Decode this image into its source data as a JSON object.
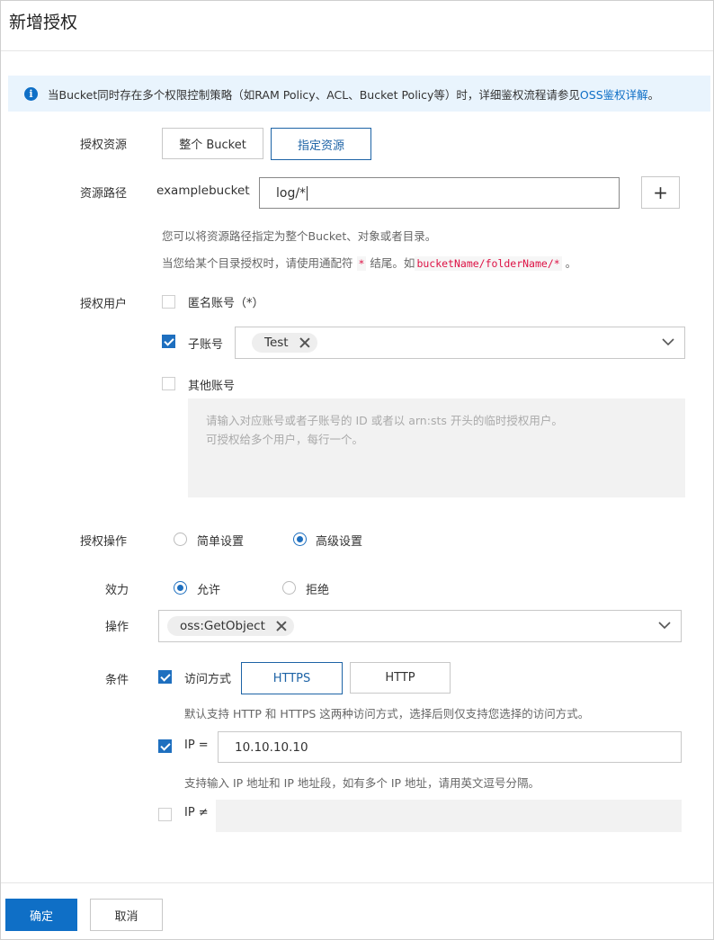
{
  "dialog": {
    "title": "新增授权"
  },
  "notice": {
    "text": "当Bucket同时存在多个权限控制策略（如RAM Policy、ACL、Bucket Policy等）时，详细鉴权流程请参见",
    "link": "OSS鉴权详解",
    "suffix": "。"
  },
  "resource": {
    "label": "授权资源",
    "options": [
      "整个 Bucket",
      "指定资源"
    ],
    "selected": "指定资源"
  },
  "path": {
    "label": "资源路径",
    "prefix": "examplebucket/",
    "value": "log/*",
    "add": "+",
    "hint1": "您可以将资源路径指定为整个Bucket、对象或者目录。",
    "hint2_pre": "当您给某个目录授权时，请使用通配符",
    "hint2_star": "*",
    "hint2_mid": "结尾。如",
    "hint2_code": "bucketName/folderName/*",
    "hint2_end": "。"
  },
  "users": {
    "label": "授权用户",
    "anonymous": {
      "label": "匿名账号（*）",
      "checked": false
    },
    "sub": {
      "label": "子账号",
      "checked": true,
      "tags": [
        "Test"
      ]
    },
    "other": {
      "label": "其他账号",
      "checked": false
    },
    "other_placeholder_1": "请输入对应账号或者子账号的 ID 或者以 arn:sts 开头的临时授权用户。",
    "other_placeholder_2": "可授权给多个用户，每行一个。"
  },
  "operation": {
    "label": "授权操作",
    "options": [
      "简单设置",
      "高级设置"
    ],
    "selected": "高级设置"
  },
  "effect": {
    "label": "效力",
    "options": [
      "允许",
      "拒绝"
    ],
    "selected": "允许"
  },
  "actions": {
    "label": "操作",
    "tags": [
      "oss:GetObject"
    ]
  },
  "conditions": {
    "label": "条件",
    "access": {
      "label": "访问方式",
      "checked": true,
      "options": [
        "HTTPS",
        "HTTP"
      ],
      "selected": "HTTPS",
      "hint": "默认支持 HTTP 和 HTTPS 这两种访问方式，选择后则仅支持您选择的访问方式。"
    },
    "ip_eq": {
      "label": "IP =",
      "checked": true,
      "value": "10.10.10.10",
      "hint": "支持输入 IP 地址和 IP 地址段，如有多个 IP 地址，请用英文逗号分隔。"
    },
    "ip_ne": {
      "label": "IP ≠",
      "checked": false,
      "value": ""
    }
  },
  "footer": {
    "confirm": "确定",
    "cancel": "取消"
  },
  "colors": {
    "primary": "#0f6fc6",
    "notice_bg": "#e9f4fd"
  }
}
